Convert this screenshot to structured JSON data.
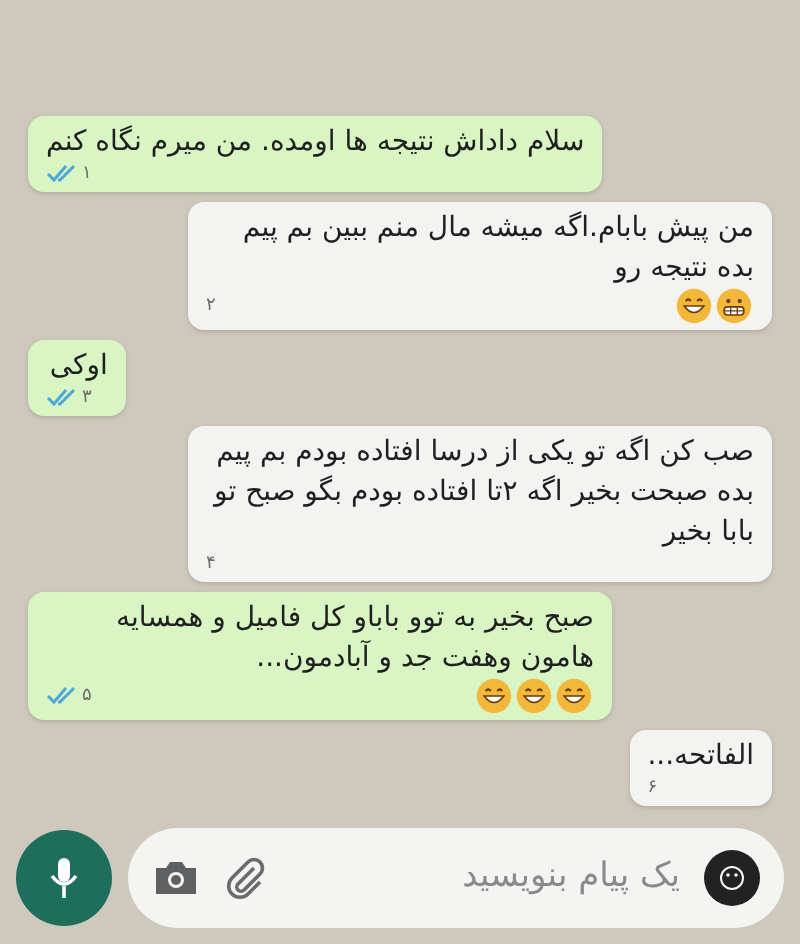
{
  "messages": [
    {
      "kind": "outgoing",
      "text": "سلام داداش نتیجه ها اومده. من میرم نگاه کنم",
      "time": "۱",
      "read": true
    },
    {
      "kind": "incoming",
      "text": "من پیش بابام.اگه میشه مال منم ببین بم پیم بده نتیجه رو",
      "time": "۲",
      "emojis": [
        {
          "kind": "grimace"
        },
        {
          "kind": "grin"
        }
      ]
    },
    {
      "kind": "outgoing",
      "text": "اوکی",
      "time": "۳",
      "read": true
    },
    {
      "kind": "incoming",
      "text": "صب کن اگه تو یکی از درسا افتاده بودم بم پیم بده صبحت بخیر اگه ۲تا افتاده بودم بگو صبح تو بابا بخیر",
      "time": "۴"
    },
    {
      "kind": "outgoing",
      "text": "صبح بخیر به توو باباو کل فامیل و همسایه هامون وهفت جد و آبادمون...",
      "time": "۵",
      "read": true,
      "emojis": [
        {
          "kind": "grin"
        },
        {
          "kind": "grin"
        },
        {
          "kind": "grin"
        }
      ]
    },
    {
      "kind": "incoming",
      "text": "الفاتحه...",
      "time": "۶"
    }
  ],
  "composer": {
    "placeholder": "یک پیام بنویسید"
  }
}
